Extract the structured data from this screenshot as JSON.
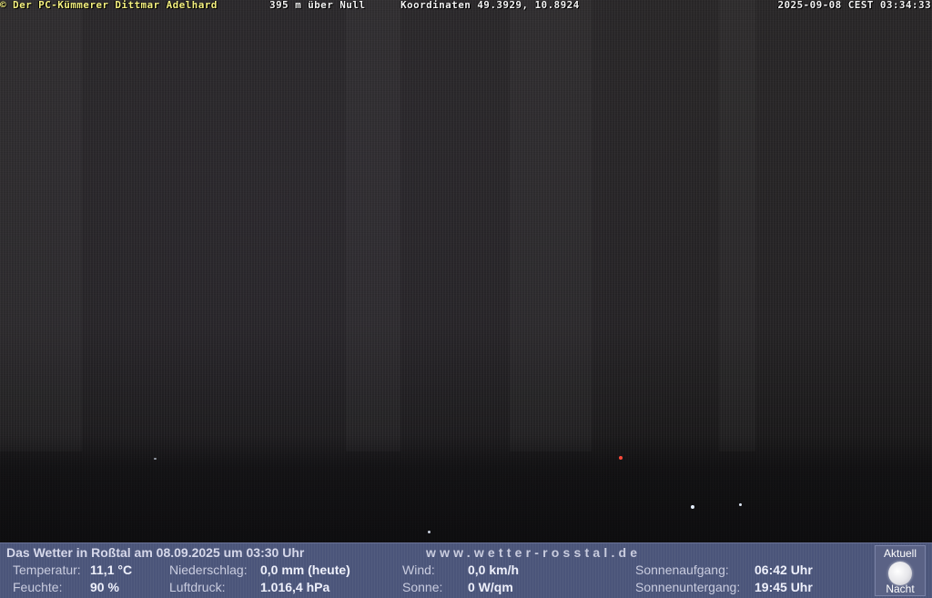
{
  "overlay": {
    "copyright": "© Der PC-Kümmerer Dittmar Adelhard",
    "elevation": "395 m über Null",
    "coordinates": "Koordinaten 49.3929, 10.8924",
    "timestamp": "2025-09-08 CEST 03:34:33"
  },
  "weather": {
    "title": "Das Wetter in Roßtal am 08.09.2025 um 03:30 Uhr",
    "website": "www.wetter-rosstal.de",
    "temperature": {
      "label": "Temperatur:",
      "value": "11,1 °C"
    },
    "humidity": {
      "label": "Feuchte:",
      "value": "90 %"
    },
    "precipitation": {
      "label": "Niederschlag:",
      "value": "0,0 mm (heute)"
    },
    "pressure": {
      "label": "Luftdruck:",
      "value": "1.016,4 hPa"
    },
    "wind": {
      "label": "Wind:",
      "value": "0,0 km/h"
    },
    "sun": {
      "label": "Sonne:",
      "value": "0 W/qm"
    },
    "sunrise": {
      "label": "Sonnenaufgang:",
      "value": "06:42 Uhr"
    },
    "sunset": {
      "label": "Sonnenuntergang:",
      "value": "19:45 Uhr"
    },
    "icon": {
      "name": "full-moon-icon",
      "top_label": "Aktuell",
      "bottom_label": "Nacht"
    }
  },
  "colors": {
    "overlay_text": "#f2f2f2",
    "copyright_text": "#f4f080",
    "panel_background": "#4b557a",
    "camera_background": "#1e1d1f"
  }
}
